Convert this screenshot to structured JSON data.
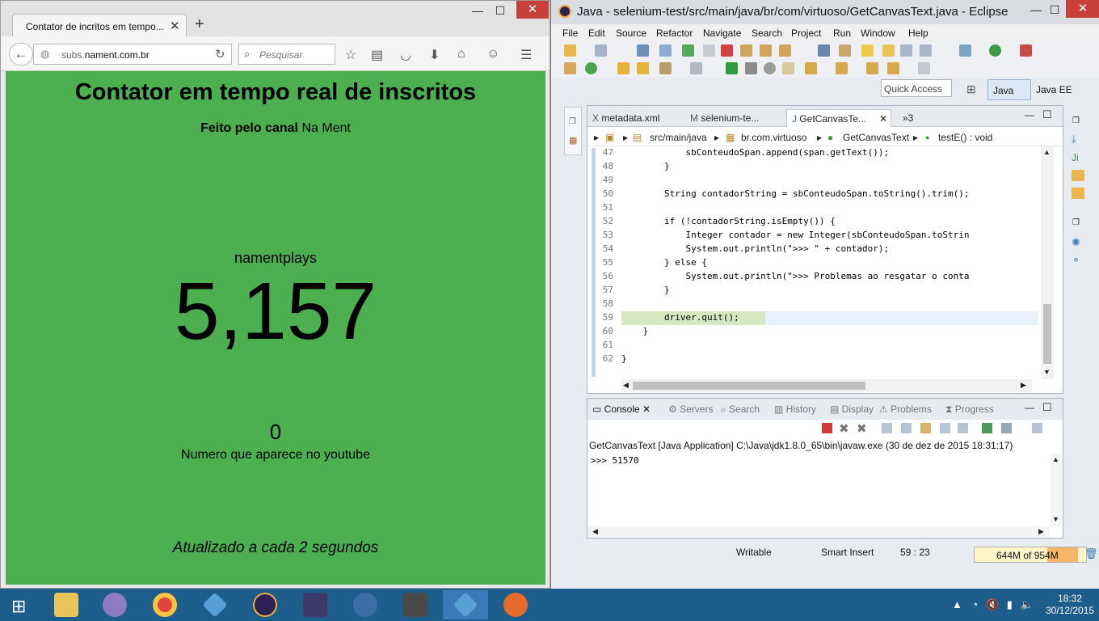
{
  "firefox": {
    "tab_title": "Contator de incritos em tempo...",
    "url_prefix": "subs.",
    "url_domain": "nament.com.br",
    "search_placeholder": "Pesquisar"
  },
  "page": {
    "title": "Contator em tempo real de inscritos",
    "sub_bold": "Feito pelo canal",
    "sub_rest": " Na Ment",
    "channel": "namentplays",
    "count": "5,157",
    "youtube_number": "0",
    "youtube_label": "Numero que aparece no youtube",
    "updated": "Atualizado a cada 2 segundos"
  },
  "eclipse": {
    "window_title": "Java - selenium-test/src/main/java/br/com/virtuoso/GetCanvasText.java - Eclipse",
    "menu": [
      "File",
      "Edit",
      "Source",
      "Refactor",
      "Navigate",
      "Search",
      "Project",
      "Run",
      "Window",
      "Help"
    ],
    "quick_access": "Quick Access",
    "perspectives": [
      "Java",
      "Java EE"
    ],
    "editor_tabs": [
      "metadata.xml",
      "selenium-te...",
      "GetCanvasTe...",
      "»3"
    ],
    "breadcrumb": [
      "src/main/java",
      "br.com.virtuoso",
      "GetCanvasText",
      "testE() : void"
    ],
    "code_lines": [
      {
        "n": "47",
        "t": "            sbConteudoSpan.append(span.getText());"
      },
      {
        "n": "48",
        "t": "        }"
      },
      {
        "n": "49",
        "t": ""
      },
      {
        "n": "50",
        "t": "        String contadorString = sbConteudoSpan.toString().trim();"
      },
      {
        "n": "51",
        "t": ""
      },
      {
        "n": "52",
        "t": "        if (!contadorString.isEmpty()) {"
      },
      {
        "n": "53",
        "t": "            Integer contador = new Integer(sbConteudoSpan.toStrin"
      },
      {
        "n": "54",
        "t": "            System.out.println(\">>> \" + contador);"
      },
      {
        "n": "55",
        "t": "        } else {"
      },
      {
        "n": "56",
        "t": "            System.out.println(\">>> Problemas ao resgatar o conta"
      },
      {
        "n": "57",
        "t": "        }"
      },
      {
        "n": "58",
        "t": ""
      },
      {
        "n": "59",
        "t": "        driver.quit();"
      },
      {
        "n": "60",
        "t": "    }"
      },
      {
        "n": "61",
        "t": ""
      },
      {
        "n": "62",
        "t": "}"
      }
    ],
    "console_tabs": [
      "Console",
      "Servers",
      "Search",
      "History",
      "Display",
      "Problems",
      "Progress"
    ],
    "console_desc": "GetCanvasText [Java Application] C:\\Java\\jdk1.8.0_65\\bin\\javaw.exe (30 de dez de 2015 18:31:17)",
    "console_output": ">>> 51570",
    "status": {
      "writable": "Writable",
      "insert": "Smart Insert",
      "position": "59 : 23",
      "heap": "644M of 954M"
    }
  },
  "taskbar": {
    "time": "18:32",
    "date": "30/12/2015"
  },
  "colors": {
    "page_bg": "#4caf50",
    "close_red": "#c7413a",
    "taskbar": "#1d5d8b"
  }
}
